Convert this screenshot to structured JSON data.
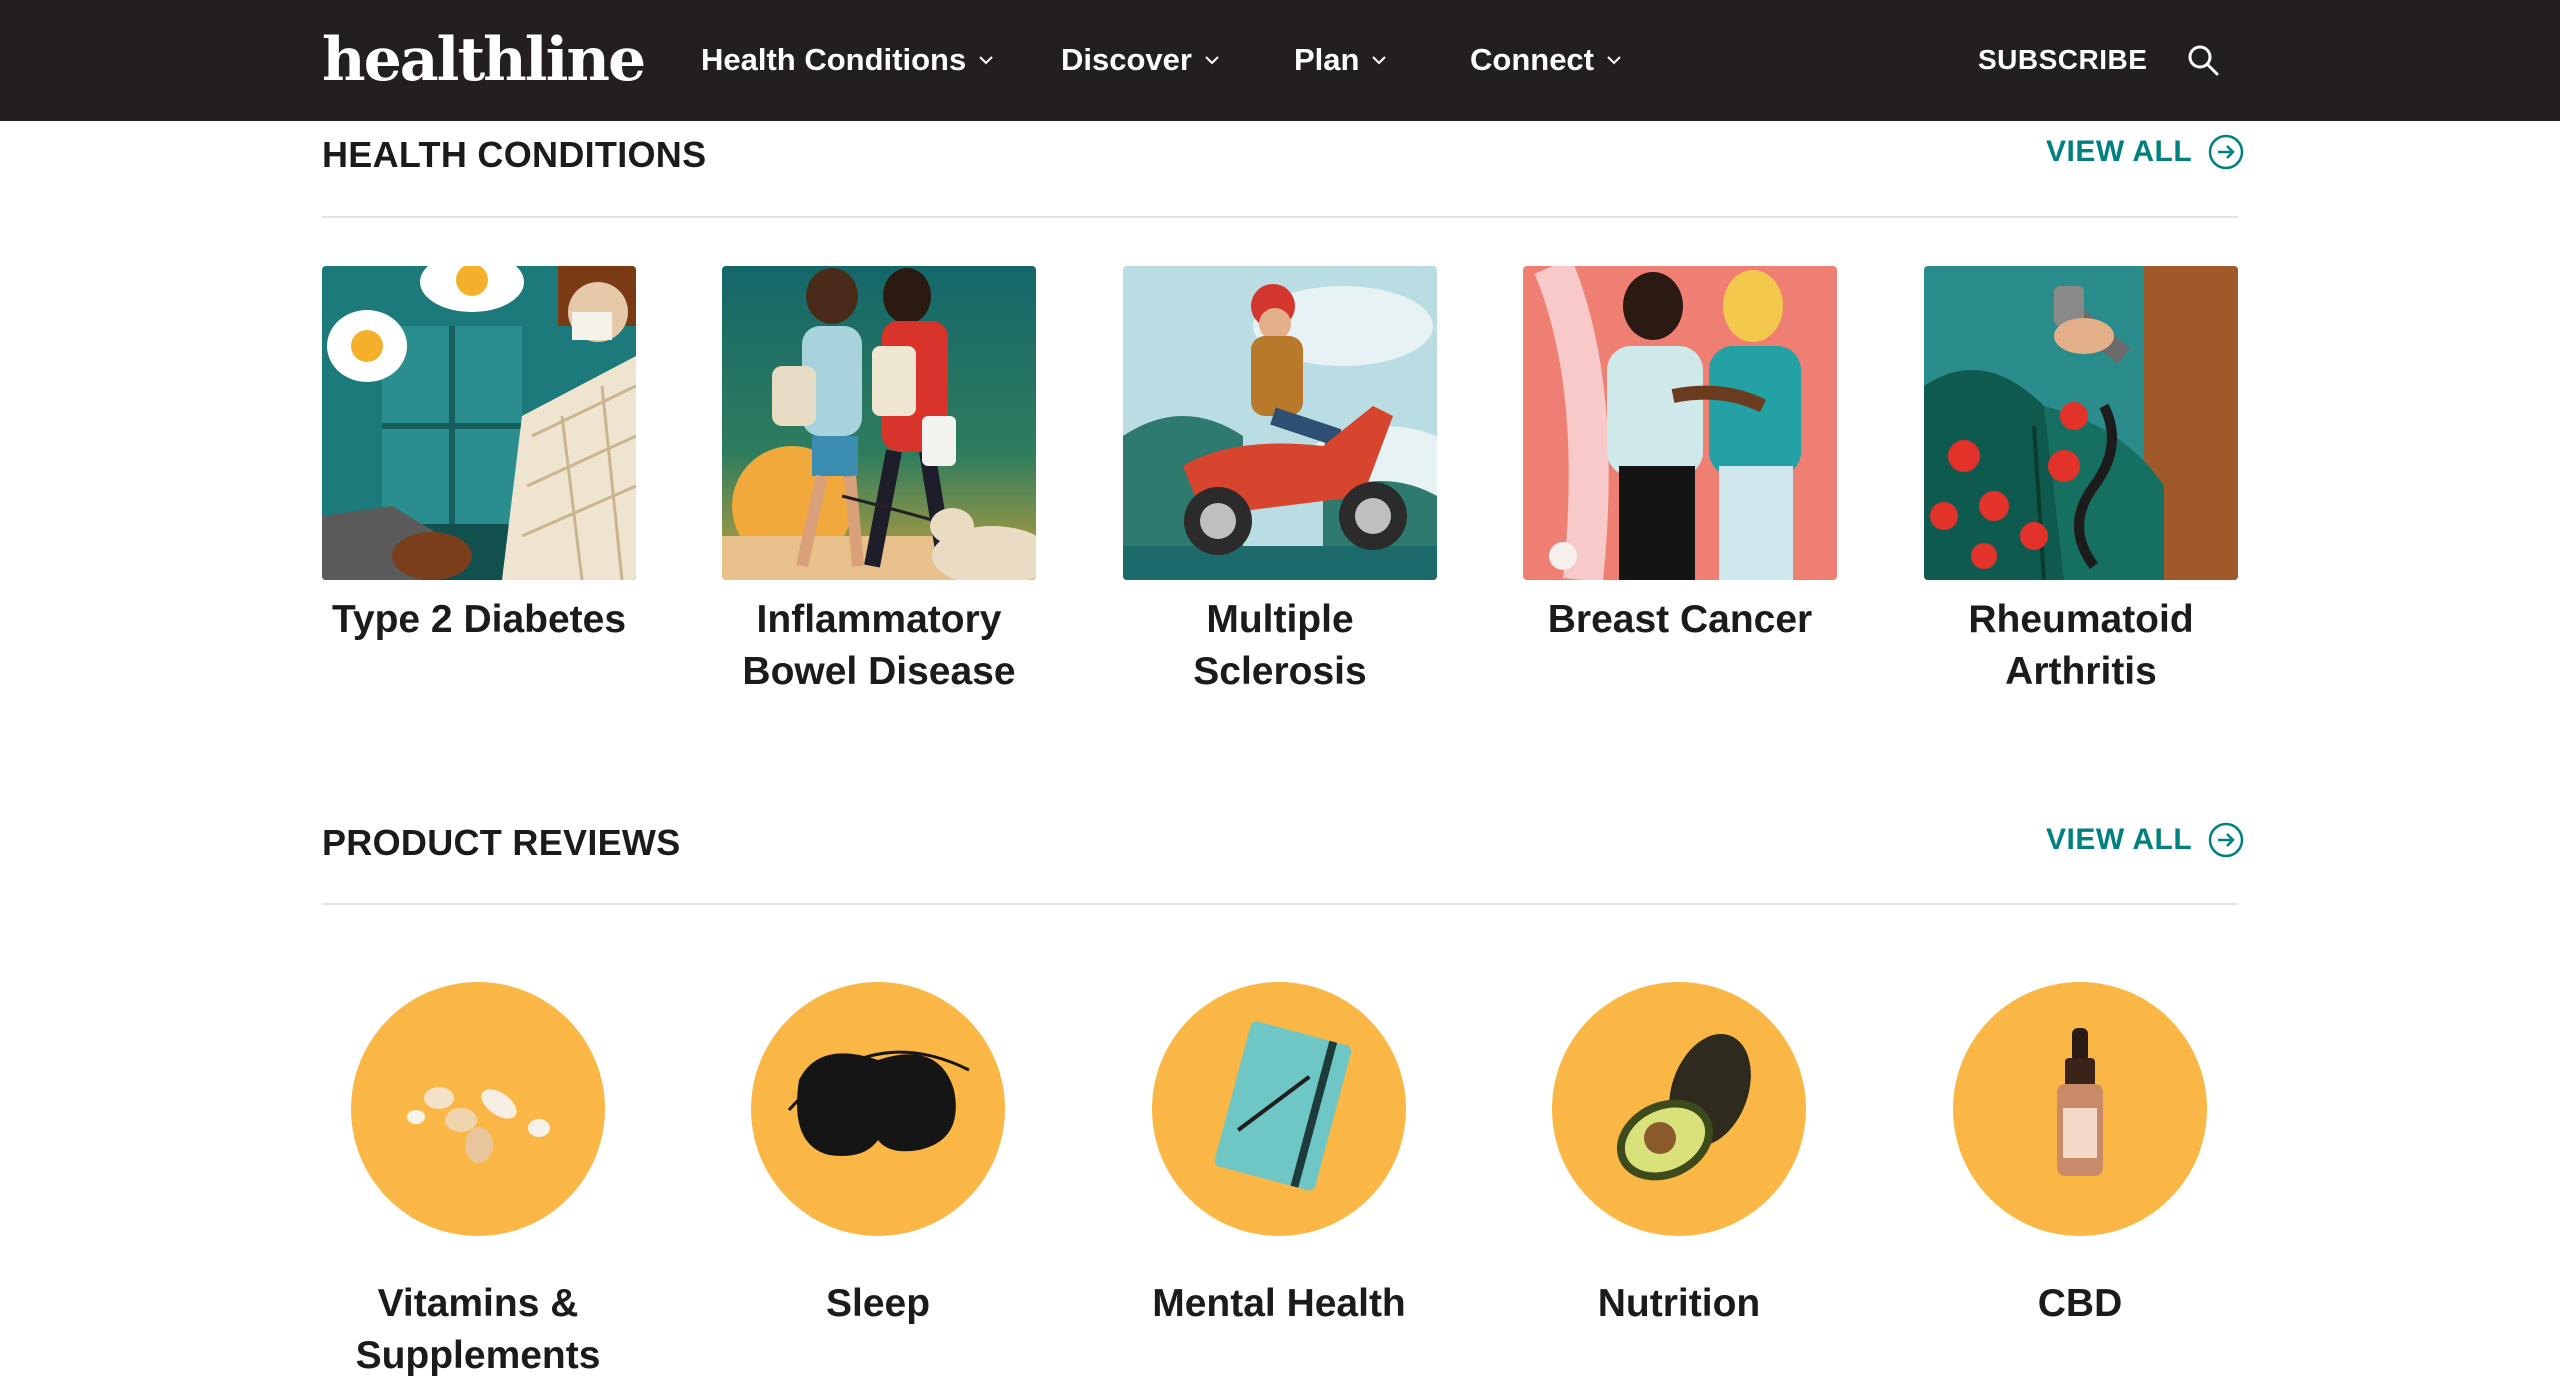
{
  "brand": {
    "logo_text": "healthline"
  },
  "nav": {
    "items": [
      {
        "label": "Health Conditions"
      },
      {
        "label": "Discover"
      },
      {
        "label": "Plan"
      },
      {
        "label": "Connect"
      }
    ],
    "subscribe_label": "SUBSCRIBE",
    "search_icon": "search-icon"
  },
  "health_conditions": {
    "title": "HEALTH CONDITIONS",
    "view_all_label": "VIEW ALL",
    "items": [
      {
        "label": "Type 2 Diabetes"
      },
      {
        "label": "Inflammatory Bowel Disease"
      },
      {
        "label": "Multiple Sclerosis"
      },
      {
        "label": "Breast Cancer"
      },
      {
        "label": "Rheumatoid Arthritis"
      }
    ]
  },
  "product_reviews": {
    "title": "PRODUCT REVIEWS",
    "view_all_label": "VIEW ALL",
    "items": [
      {
        "label": "Vitamins & Supplements"
      },
      {
        "label": "Sleep"
      },
      {
        "label": "Mental Health"
      },
      {
        "label": "Nutrition"
      },
      {
        "label": "CBD"
      }
    ]
  },
  "colors": {
    "nav_background": "#231f20",
    "accent_teal": "#008080",
    "circle_yellow": "#fbb746",
    "divider": "#e3e3e3"
  }
}
